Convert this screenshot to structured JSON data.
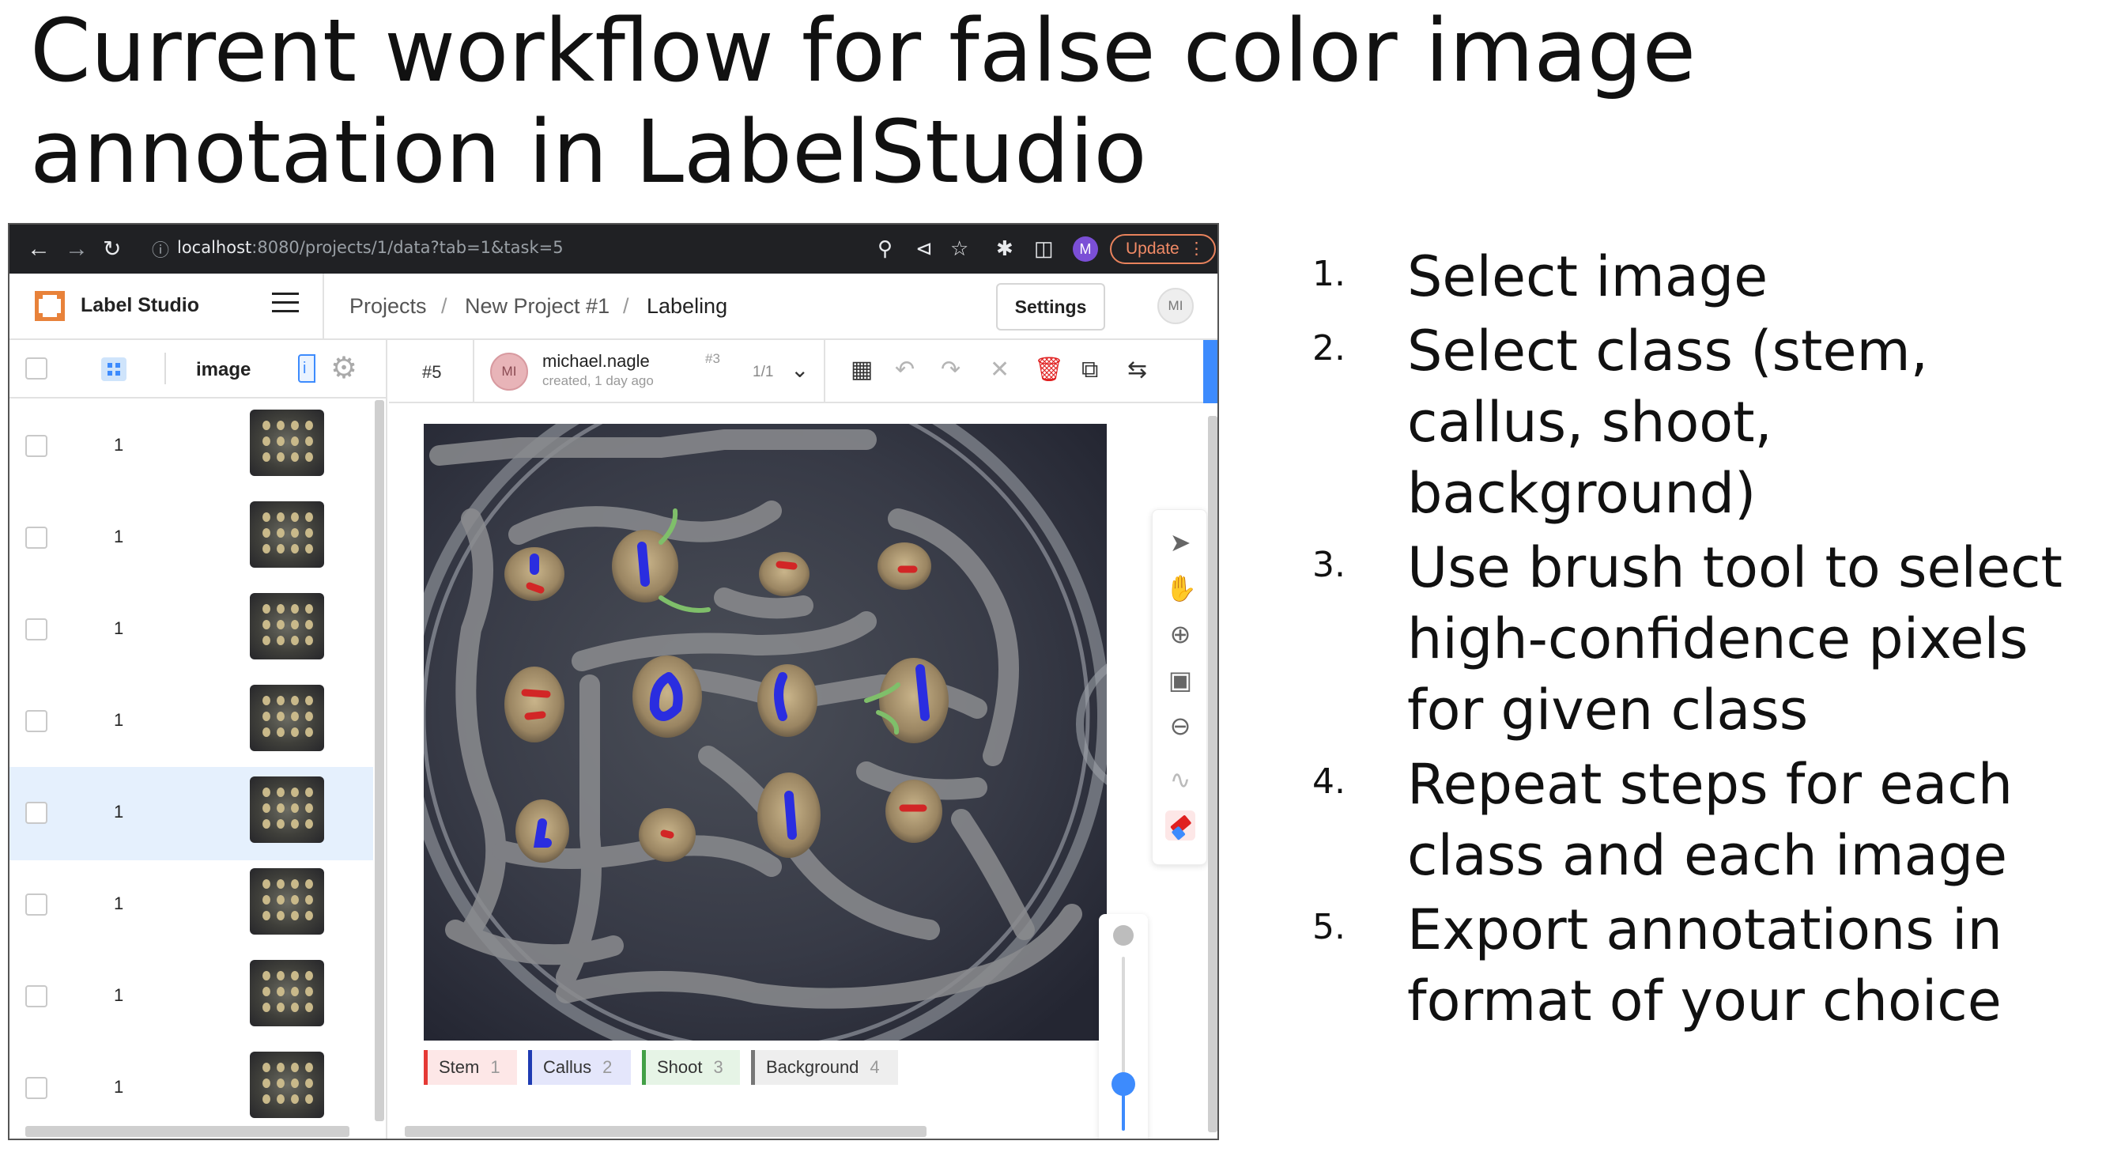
{
  "slide": {
    "title": "Current workflow for false color image annotation in LabelStudio"
  },
  "browser": {
    "url_host": "localhost",
    "url_path": ":8080/projects/1/data?tab=1&task=5",
    "profile_initial": "M",
    "update_label": "Update"
  },
  "ls": {
    "brand": "Label Studio",
    "breadcrumbs": [
      "Projects",
      "New Project #1",
      "Labeling"
    ],
    "settings_label": "Settings",
    "user_initials": "MI"
  },
  "task_list": {
    "column_label": "image",
    "column_tag": "i",
    "rows": [
      {
        "id": "1"
      },
      {
        "id": "1"
      },
      {
        "id": "1"
      },
      {
        "id": "1"
      },
      {
        "id": "1",
        "selected": true
      },
      {
        "id": "1"
      },
      {
        "id": "1"
      },
      {
        "id": "1"
      }
    ]
  },
  "annotation": {
    "task_number": "#5",
    "avatar_initials": "MI",
    "user": "michael.nagle",
    "meta": "created, 1 day ago",
    "annotation_index": "#3",
    "count": "1/1"
  },
  "labels": [
    {
      "name": "Stem",
      "hotkey": "1",
      "color": "#e53935",
      "bg": "#fde7e7"
    },
    {
      "name": "Callus",
      "hotkey": "2",
      "color": "#1e3bb3",
      "bg": "#e4e6fb"
    },
    {
      "name": "Shoot",
      "hotkey": "3",
      "color": "#43a047",
      "bg": "#e6f4e6"
    },
    {
      "name": "Background",
      "hotkey": "4",
      "color": "#777777",
      "bg": "#eeeeee"
    }
  ],
  "steps": [
    {
      "num": "1.",
      "text": "Select image"
    },
    {
      "num": "2.",
      "text": "Select class (stem, callus, shoot, background)"
    },
    {
      "num": "3.",
      "text": "Use brush tool to select high-confidence pixels for given class"
    },
    {
      "num": "4.",
      "text": "Repeat steps for each class and each image"
    },
    {
      "num": "5.",
      "text": "Export annotations in format of your choice"
    }
  ]
}
